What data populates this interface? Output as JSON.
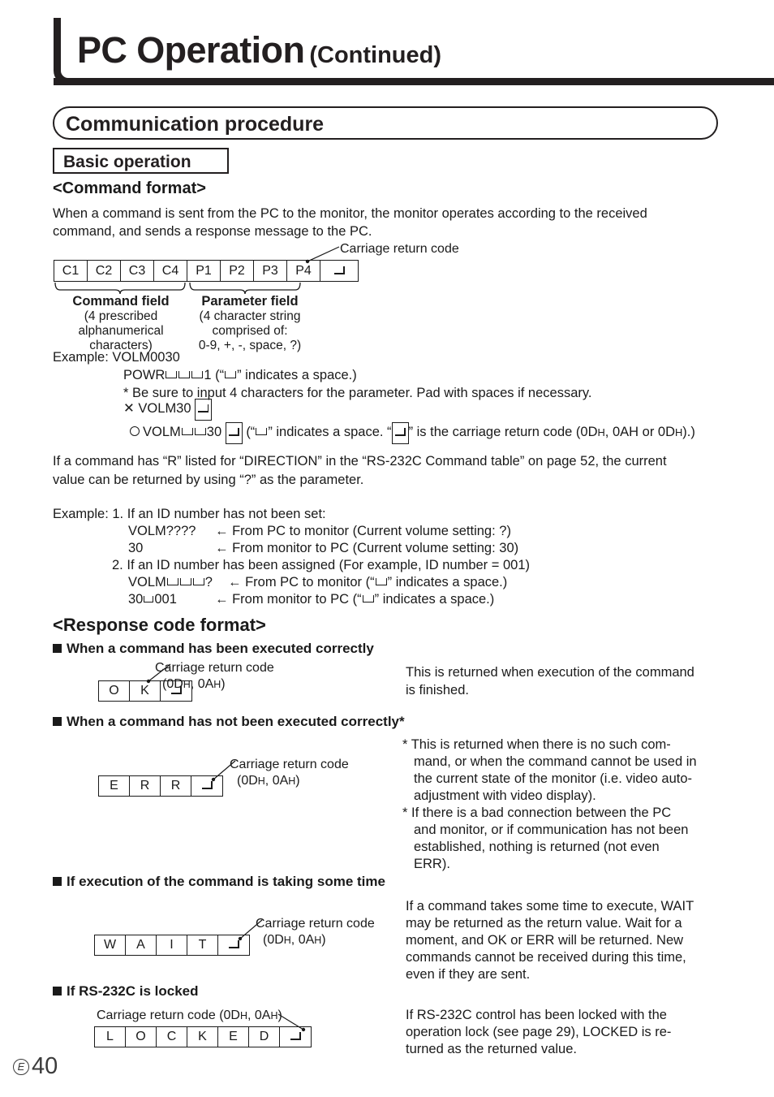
{
  "header": {
    "title_main": "PC Operation",
    "title_continued": "(Continued)"
  },
  "banners": {
    "communication_procedure": "Communication procedure",
    "basic_operation": "Basic operation"
  },
  "command_format": {
    "heading": "<Command format>",
    "intro_line1": "When a command is sent from the PC to the monitor, the monitor operates according to the received",
    "intro_line2": "command, and sends a response message to the PC.",
    "carriage_return_callout": "Carriage return code",
    "frame_cells": [
      "C1",
      "C2",
      "C3",
      "C4",
      "P1",
      "P2",
      "P3",
      "P4"
    ],
    "command_field": {
      "title": "Command field",
      "line1": "(4 prescribed",
      "line2": "alphanumerical",
      "line3": "characters)"
    },
    "parameter_field": {
      "title": "Parameter field",
      "line1": "(4 character string",
      "line2": "comprised of:",
      "line3": "0-9, +, -, space, ?)"
    },
    "example_label": "Example:",
    "example_value": "VOLM0030",
    "powr_prefix": "POWR",
    "powr_suffix": "1 (“",
    "powr_tail": "” indicates a space.)",
    "note_asterisk": "* Be sure to input 4 characters for the parameter. Pad with spaces if necessary.",
    "bad_mark": "✕",
    "bad_example": "VOLM30",
    "good_prefix": "VOLM",
    "good_mid": "30",
    "good_tail_1": "(“",
    "good_tail_2": "” indicates a space. “",
    "good_tail_3": "” is the carriage return code (0D",
    "good_tail_4": ", 0AH or 0D",
    "good_tail_5": ").)"
  },
  "direction_note": {
    "line1": "If a command has “R” listed for “DIRECTION” in the “RS-232C Command table” on page 52, the current",
    "line2": "value can be returned by using “?” as the parameter."
  },
  "id_examples": {
    "label": "Example:",
    "item1_number": "1.",
    "item1_text": "If an ID number has not been set:",
    "row1_cmd": "VOLM????",
    "row1_desc": "← From PC to monitor (Current volume setting: ?)",
    "row2_cmd": "30",
    "row2_desc": "← From monitor to PC (Current volume setting: 30)",
    "item2_number": "2.",
    "item2_text": "If an ID number has been assigned (For example, ID number = 001)",
    "row3_cmd_prefix": "VOLM",
    "row3_cmd_suffix": "?",
    "row3_desc_a": "← From PC to monitor (“",
    "row3_desc_b": "” indicates a space.)",
    "row4_cmd_prefix": "30",
    "row4_cmd_suffix": "001",
    "row4_desc_a": "← From monitor to PC (“",
    "row4_desc_b": "”  indicates a space.)"
  },
  "response_format": {
    "heading": "<Response code format>",
    "sections": [
      {
        "title": "When a command has been executed correctly",
        "cells": [
          "O",
          "K"
        ],
        "callout_line1": "Carriage return code",
        "callout_line2": "(0D",
        "callout_line2b": ", 0A",
        "callout_line2c": ")",
        "desc_line1": "This is returned when execution of the command",
        "desc_line2": "is finished."
      },
      {
        "title": "When a command has not been executed correctly*",
        "cells": [
          "E",
          "R",
          "R"
        ],
        "callout_line1": "Carriage return code",
        "desc_line1": "*  This is returned when there is no such com-",
        "desc_line2": "mand, or when the command cannot be used in",
        "desc_line3": "the current state of the monitor (i.e. video auto-",
        "desc_line4": "adjustment with video display).",
        "desc_line5": "*  If there is a bad connection between the PC",
        "desc_line6": "and monitor, or if communication has not been",
        "desc_line7": "established, nothing is returned (not even",
        "desc_line8": "ERR)."
      },
      {
        "title": "If execution of the command is taking some time",
        "cells": [
          "W",
          "A",
          "I",
          "T"
        ],
        "callout_line1": "Carriage return code",
        "desc_line1": "If a command takes some time to execute, WAIT",
        "desc_line2": "may be returned as the return value. Wait for a",
        "desc_line3": "moment, and OK or ERR will be returned. New",
        "desc_line4": "commands cannot be received during this time,",
        "desc_line5": "even if they are sent."
      },
      {
        "title": "If RS-232C is locked",
        "cells": [
          "L",
          "O",
          "C",
          "K",
          "E",
          "D"
        ],
        "callout_inline": "Carriage return code (0D",
        "desc_line1": "If RS-232C control has been locked with the",
        "desc_line2": "operation lock (see page 29), LOCKED is re-",
        "desc_line3": "turned as the returned value."
      }
    ]
  },
  "footer": {
    "lang_mark": "E",
    "page_number": "40"
  }
}
